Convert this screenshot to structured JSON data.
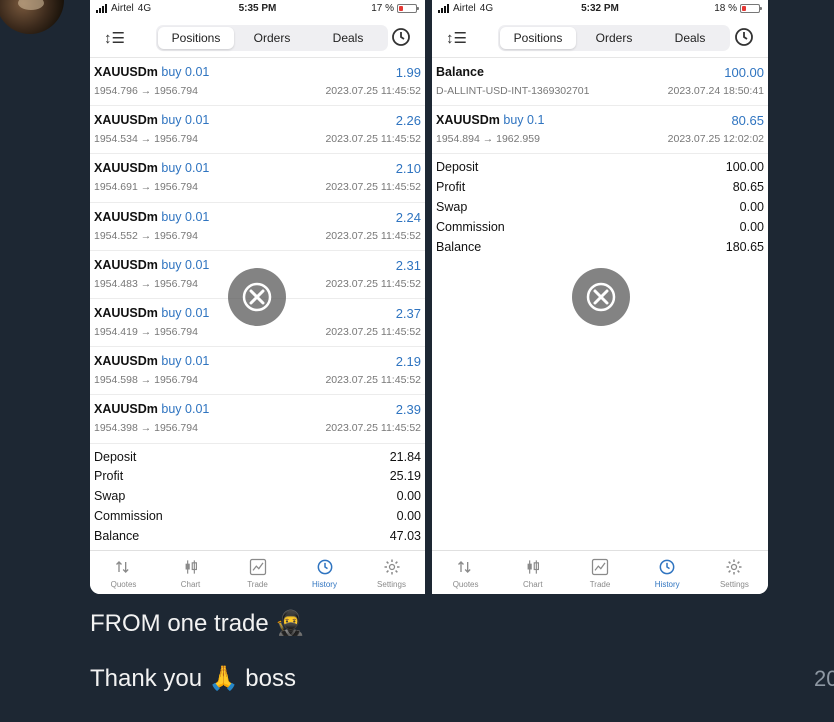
{
  "left": {
    "status": {
      "carrier": "Airtel",
      "network": "4G",
      "time": "5:35 PM",
      "battery": "17 %"
    },
    "tabs": [
      "Positions",
      "Orders",
      "Deals"
    ],
    "active_tab": "Positions",
    "rows": [
      {
        "symbol": "XAUUSDm",
        "side": "buy 0.01",
        "profit": "1.99",
        "prices": "1954.796 → 1956.794",
        "time": "2023.07.25 11:45:52"
      },
      {
        "symbol": "XAUUSDm",
        "side": "buy 0.01",
        "profit": "2.26",
        "prices": "1954.534 → 1956.794",
        "time": "2023.07.25 11:45:52"
      },
      {
        "symbol": "XAUUSDm",
        "side": "buy 0.01",
        "profit": "2.10",
        "prices": "1954.691 → 1956.794",
        "time": "2023.07.25 11:45:52"
      },
      {
        "symbol": "XAUUSDm",
        "side": "buy 0.01",
        "profit": "2.24",
        "prices": "1954.552 → 1956.794",
        "time": "2023.07.25 11:45:52"
      },
      {
        "symbol": "XAUUSDm",
        "side": "buy 0.01",
        "profit": "2.31",
        "prices": "1954.483 → 1956.794",
        "time": "2023.07.25 11:45:52"
      },
      {
        "symbol": "XAUUSDm",
        "side": "buy 0.01",
        "profit": "2.37",
        "prices": "1954.419 → 1956.794",
        "time": "2023.07.25 11:45:52"
      },
      {
        "symbol": "XAUUSDm",
        "side": "buy 0.01",
        "profit": "2.19",
        "prices": "1954.598 → 1956.794",
        "time": "2023.07.25 11:45:52"
      },
      {
        "symbol": "XAUUSDm",
        "side": "buy 0.01",
        "profit": "2.39",
        "prices": "1954.398 → 1956.794",
        "time": "2023.07.25 11:45:52"
      }
    ],
    "summary": [
      {
        "label": "Deposit",
        "value": "21.84"
      },
      {
        "label": "Profit",
        "value": "25.19"
      },
      {
        "label": "Swap",
        "value": "0.00"
      },
      {
        "label": "Commission",
        "value": "0.00"
      },
      {
        "label": "Balance",
        "value": "47.03"
      }
    ]
  },
  "right": {
    "status": {
      "carrier": "Airtel",
      "network": "4G",
      "time": "5:32 PM",
      "battery": "18 %"
    },
    "tabs": [
      "Positions",
      "Orders",
      "Deals"
    ],
    "active_tab": "Positions",
    "rows": [
      {
        "symbol": "Balance",
        "side": "",
        "profit": "100.00",
        "prices": "D-ALLINT-USD-INT-1369302701",
        "time": "2023.07.24 18:50:41"
      },
      {
        "symbol": "XAUUSDm",
        "side": "buy 0.1",
        "profit": "80.65",
        "prices": "1954.894 → 1962.959",
        "time": "2023.07.25 12:02:02"
      }
    ],
    "summary": [
      {
        "label": "Deposit",
        "value": "100.00"
      },
      {
        "label": "Profit",
        "value": "80.65"
      },
      {
        "label": "Swap",
        "value": "0.00"
      },
      {
        "label": "Commission",
        "value": "0.00"
      },
      {
        "label": "Balance",
        "value": "180.65"
      }
    ]
  },
  "tabbar": [
    "Quotes",
    "Chart",
    "Trade",
    "History",
    "Settings"
  ],
  "tabbar_active": "History",
  "messages": [
    "FROM one trade 🥷",
    "Thank you 🙏 boss"
  ],
  "timestamp": "20",
  "colors": {
    "accent": "#2f74c0",
    "chat_bg": "#1d2733"
  }
}
